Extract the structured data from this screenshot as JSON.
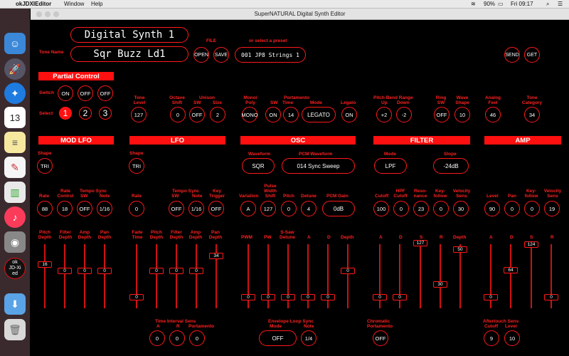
{
  "menubar": {
    "app": "okJDXIEditor",
    "window": "Window",
    "help": "Help",
    "battery": "90%",
    "clock": "Fri 09:17"
  },
  "window_title": "SuperNATURAL Digital Synth Editor",
  "header": {
    "synth_name": "Digital Synth 1",
    "tone_name_label": "Tone Name",
    "tone_name": "Sqr Buzz Ld1",
    "file_label": "FILE",
    "open": "OPEN",
    "save": "SAVE",
    "preset_label": "or select a preset",
    "preset": "001 JP8 Strings 1",
    "send": "SEND",
    "get": "GET"
  },
  "partial": {
    "title": "Partial Control",
    "switch_label": "Switch",
    "select_label": "Select",
    "switches": [
      "ON",
      "OFF",
      "OFF"
    ],
    "selects": [
      "1",
      "2",
      "3"
    ]
  },
  "tone": {
    "level_label": "Tone Level",
    "level": "127",
    "octave_label": "Octave Shift",
    "octave": "0",
    "unison_label": "Unison",
    "sw_label": "SW",
    "size_label": "Size",
    "unison_sw": "OFF",
    "unison_size": "2",
    "mono_label": "Mono/ Poly",
    "mono": "MONO",
    "porta_label": "Portamento",
    "porta_sw": "ON",
    "time_label": "Time",
    "porta_time": "14",
    "mode_label": "Mode",
    "porta_mode": "LEGATO",
    "legato_label": "Legato",
    "legato": "ON",
    "pb_label": "Pitch Bend Range",
    "up_label": "Up",
    "down_label": "Down",
    "pb_up": "+2",
    "pb_down": "-2",
    "ring_label": "Ring SW",
    "ring": "OFF",
    "wave_shape_label": "Wave Shape",
    "wave_shape": "10",
    "analog_label": "Analog Feel",
    "analog": "46",
    "category_label": "Tone Category",
    "category": "34"
  },
  "sections": {
    "modlfo": "MOD LFO",
    "lfo": "LFO",
    "osc": "OSC",
    "filter": "FILTER",
    "amp": "AMP"
  },
  "modlfo": {
    "shape_label": "Shape",
    "shape": "TRI",
    "rate_label": "Rate",
    "rate": "88",
    "rc_label": "Rate Control",
    "rc": "18",
    "tsync_label": "Tempo Sync",
    "sw_label": "SW",
    "note_label": "Note",
    "ts_sw": "OFF",
    "ts_note": "1/16",
    "pitch_label": "Pitch Depth",
    "filter_label": "Filter Depth",
    "amp_label": "Amp Depth",
    "pan_label": "Pan Depth",
    "pitch": "16",
    "filter": "0",
    "amp": "0",
    "pan": "0"
  },
  "lfo": {
    "shape_label": "Shape",
    "shape": "TRI",
    "rate_label": "Rate",
    "rate": "0",
    "tsync_label": "Tempo Sync",
    "sw_label": "SW",
    "note_label": "Note",
    "ts_sw": "OFF",
    "ts_note": "1/16",
    "key_label": "Key Trigger",
    "key": "OFF",
    "fade_label": "Fade Time",
    "pitch_label": "Pitch Depth",
    "filter_label": "Filter Depth",
    "amp_label": "Amp Depth",
    "pan_label": "Pan Depth",
    "fade": "0",
    "pitch": "0",
    "filter": "0",
    "amp": "0",
    "pan": "34"
  },
  "osc": {
    "waveform_label": "Waveform",
    "waveform": "SQR",
    "pcm_label": "PCM Waveform",
    "pcm": "014 Sync Sweep",
    "variation_label": "Variation",
    "variation": "A",
    "pw_shift_label": "Pulse Width Shift",
    "pw_shift": "127",
    "pitch_label": "Pitch",
    "pitch": "0",
    "detune_label": "Detune",
    "detune": "4",
    "gain_label": "PCM Gain",
    "gain": "0dB",
    "pwm_label": "PWM",
    "pw_label": "PW",
    "ssaw_label": "S-Saw Detune",
    "a_label": "A",
    "d_label": "D",
    "depth_label": "Depth",
    "pwm": "0",
    "pw": "0",
    "ssaw": "0",
    "a": "0",
    "d": "0",
    "depth": "0"
  },
  "filter": {
    "mode_label": "Mode",
    "mode": "LPF",
    "slope_label": "Slope",
    "slope": "-24dB",
    "cutoff_label": "Cutoff",
    "cutoff": "100",
    "hpf_label": "HPF Cutoff",
    "hpf": "0",
    "res_label": "Reso- nance",
    "res": "23",
    "kf_label": "Key- follow",
    "kf": "0",
    "vs_label": "Velocity Sens",
    "vs": "30",
    "a_label": "A",
    "d_label": "D",
    "s_label": "S",
    "r_label": "R",
    "depth_label": "Depth",
    "a": "0",
    "d": "0",
    "s": "127",
    "r": "30",
    "depth": "50"
  },
  "amp": {
    "level_label": "Level",
    "level": "90",
    "pan_label": "Pan",
    "pan": "0",
    "kf_label": "Key- follow",
    "kf": "0",
    "vs_label": "Velocity Sens",
    "vs": "19",
    "a_label": "A",
    "d_label": "D",
    "s_label": "S",
    "r_label": "R",
    "a": "0",
    "d": "64",
    "s": "124",
    "r": "0"
  },
  "bottom": {
    "tis_label": "Time Interval Sens",
    "a_label": "A",
    "r_label": "R",
    "porta_label": "Portamento",
    "tis_a": "0",
    "tis_r": "0",
    "tis_p": "0",
    "env_label": "Envelope Loop Sync",
    "mode_label": "Mode",
    "note_label": "Note",
    "env_mode": "OFF",
    "env_note": "1/4",
    "chrom_label": "Chromatic Portamento",
    "chrom": "OFF",
    "at_label": "Aftertouch Sens",
    "cutoff_label": "Cutoff",
    "level_label": "Level",
    "at_cutoff": "9",
    "at_level": "10"
  }
}
